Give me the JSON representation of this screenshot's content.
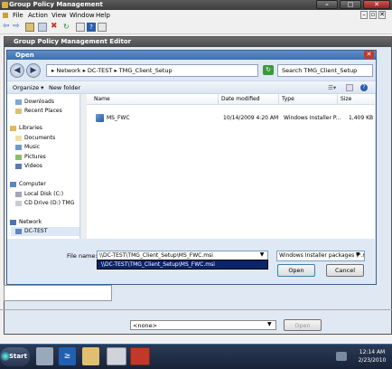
{
  "gpm": {
    "title": "Group Policy Management",
    "menu": [
      "File",
      "Action",
      "View",
      "Window",
      "Help"
    ]
  },
  "editor": {
    "title": "Group Policy Management Editor"
  },
  "dialog": {
    "title": "Open",
    "breadcrumb": [
      "Network",
      "DC-TEST",
      "TMG_Client_Setup"
    ],
    "search_placeholder": "Search TMG_Client_Setup",
    "organize_label": "Organize ▾",
    "new_folder_label": "New folder",
    "nav": {
      "favorites": [
        "Downloads",
        "Recent Places"
      ],
      "libraries_header": "Libraries",
      "libraries": [
        "Documents",
        "Music",
        "Pictures",
        "Videos"
      ],
      "computer_header": "Computer",
      "computer": [
        "Local Disk (C:)",
        "CD Drive (D:) TMG"
      ],
      "network_header": "Network",
      "network": [
        "DC-TEST"
      ]
    },
    "columns": [
      "Name",
      "Date modified",
      "Type",
      "Size"
    ],
    "files": [
      {
        "name": "MS_FWC",
        "date": "10/14/2009 4:20 AM",
        "type": "Windows Installer P...",
        "size": "1,409 KB"
      }
    ],
    "file_name_label": "File name:",
    "file_name_value": "\\\\DC-TEST\\TMG_Client_Setup\\MS_FWC.msi",
    "autocomplete_value": "\\\\DC-TEST\\TMG_Client_Setup\\MS_FWC.msi",
    "file_type_value": "Windows Installer packages (*.r",
    "open_label": "Open",
    "cancel_label": "Cancel"
  },
  "gpm_lower": {
    "none_value": "<none>",
    "open_label": "Open"
  },
  "taskbar": {
    "start_label": "Start",
    "time": "12:14 AM",
    "date": "2/23/2010"
  }
}
